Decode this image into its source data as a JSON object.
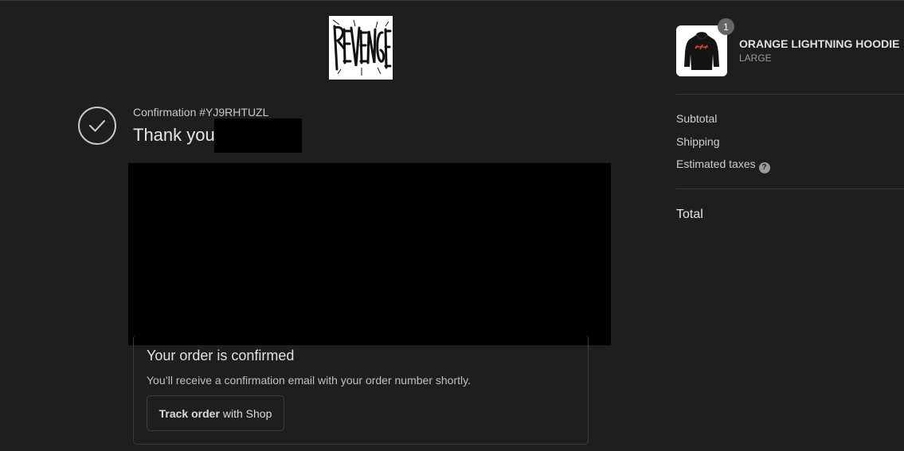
{
  "brand": {
    "logo_text": "Revenge"
  },
  "order": {
    "confirmation_label": "Confirmation #YJ9RHTUZL",
    "thank_you": "Thank you"
  },
  "confirm_card": {
    "title": "Your order is confirmed",
    "description": "You’ll receive a confirmation email with your order number shortly.",
    "track_button": {
      "strong": "Track order",
      "rest": "with Shop"
    }
  },
  "summary": {
    "product": {
      "name": "ORANGE LIGHTNING HOODIE",
      "variant": "LARGE",
      "quantity": "1"
    },
    "rows": {
      "subtotal": "Subtotal",
      "shipping": "Shipping",
      "estimated_taxes": "Estimated taxes",
      "help_glyph": "?"
    },
    "total_label": "Total"
  },
  "colors": {
    "background": "#1e1e1e",
    "text": "#d6d6d6",
    "border": "#3a3a3a",
    "redaction": "#000000",
    "hoodie_print": "#d9401a"
  }
}
